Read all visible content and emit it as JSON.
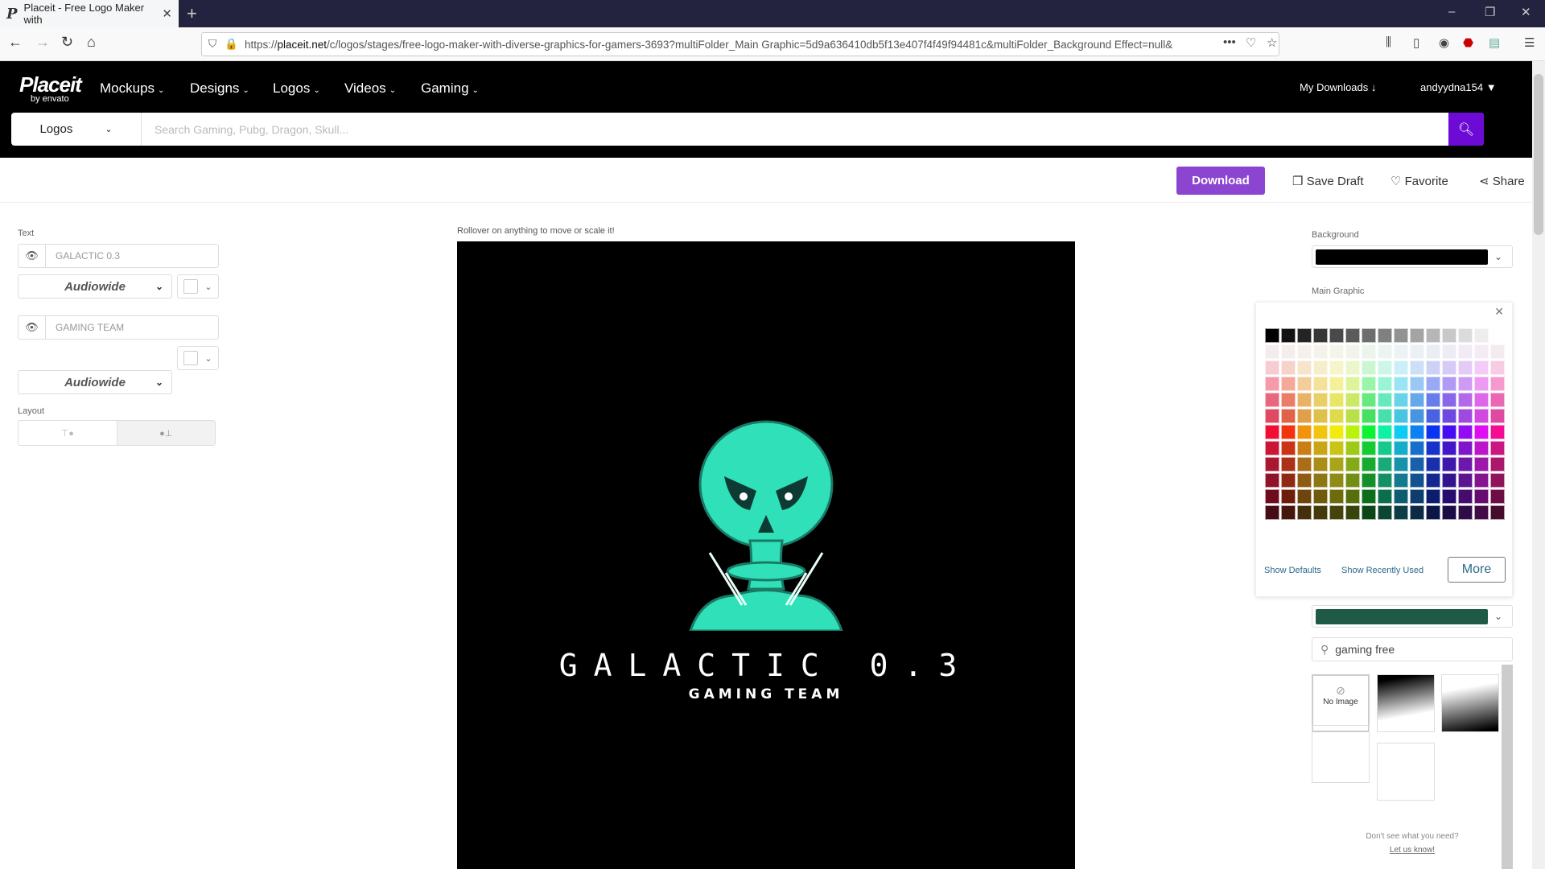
{
  "browser": {
    "tab_title": "Placeit - Free Logo Maker with",
    "url_host": "placeit.net",
    "url_prefix": "https://",
    "url_rest": "/c/logos/stages/free-logo-maker-with-diverse-graphics-for-gamers-3693?multiFolder_Main Graphic=5d9a636410db5f13e407f4f49f94481c&multiFolder_Background Effect=null&"
  },
  "nav": {
    "logo": "Placeit",
    "logo_sub": "by envato",
    "menus": [
      "Mockups",
      "Designs",
      "Logos",
      "Videos",
      "Gaming"
    ],
    "my_downloads": "My Downloads",
    "username": "andyydna154"
  },
  "search": {
    "category": "Logos",
    "placeholder": "Search Gaming, Pubg, Dragon, Skull..."
  },
  "actions": {
    "download": "Download",
    "save_draft": "Save Draft",
    "favorite": "Favorite",
    "share": "Share"
  },
  "left": {
    "text_label": "Text",
    "line1": "GALACTIC 0.3",
    "line2": "GAMING TEAM",
    "font1": "Audiowide",
    "font2": "Audiowide",
    "layout_label": "Layout"
  },
  "canvas": {
    "hint": "Rollover on anything to move or scale it!",
    "title": "GALACTIC 0.3",
    "subtitle": "GAMING TEAM",
    "graphic_color": "#2fe0b8"
  },
  "right": {
    "background_label": "Background",
    "background_color": "#000000",
    "main_graphic_label": "Main Graphic",
    "main_graphic_color": "#1e5a45",
    "show_defaults": "Show Defaults",
    "show_recently_used": "Show Recently Used",
    "more": "More",
    "bg_search": "gaming free",
    "no_image": "No Image",
    "dont_see": "Don't see what you need?",
    "let_us_know": "Let us know!"
  }
}
